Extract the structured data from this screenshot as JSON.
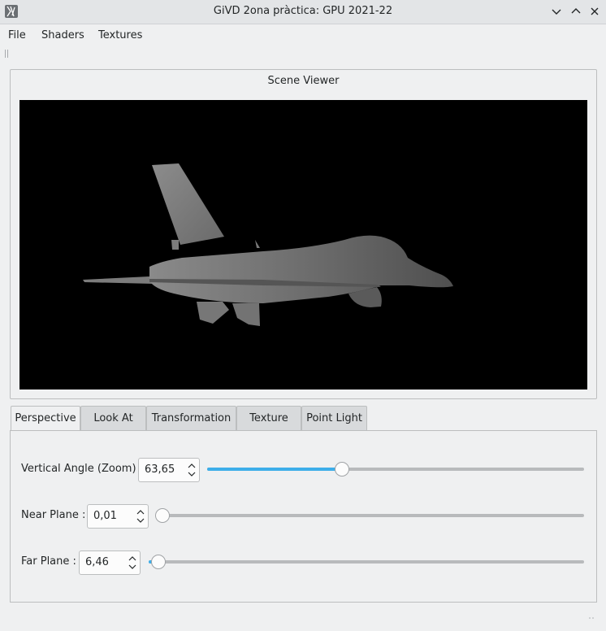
{
  "window": {
    "title": "GiVD 2ona pràctica: GPU 2021-22",
    "controls": [
      "minimize",
      "maximize",
      "close"
    ]
  },
  "menubar": {
    "items": [
      "File",
      "Shaders",
      "Textures"
    ]
  },
  "scene": {
    "title": "Scene Viewer",
    "background_color": "#000000",
    "model_icon": "jet-fighter"
  },
  "tabs": {
    "items": [
      "Perspective",
      "Look At",
      "Transformation",
      "Texture",
      "Point Light"
    ],
    "active": "Perspective"
  },
  "perspective": {
    "vertical_angle": {
      "label": "Vertical Angle (Zoom) :",
      "value": "63,65",
      "slider_fraction": 0.36
    },
    "near_plane": {
      "label": "Near Plane :",
      "value": "0,01",
      "slider_fraction": 0.0
    },
    "far_plane": {
      "label": "Far Plane :",
      "value": "6,46",
      "slider_fraction": 0.0
    }
  },
  "colors": {
    "accent": "#3daee9",
    "window_bg": "#eff0f1",
    "border": "#bcbebf"
  }
}
